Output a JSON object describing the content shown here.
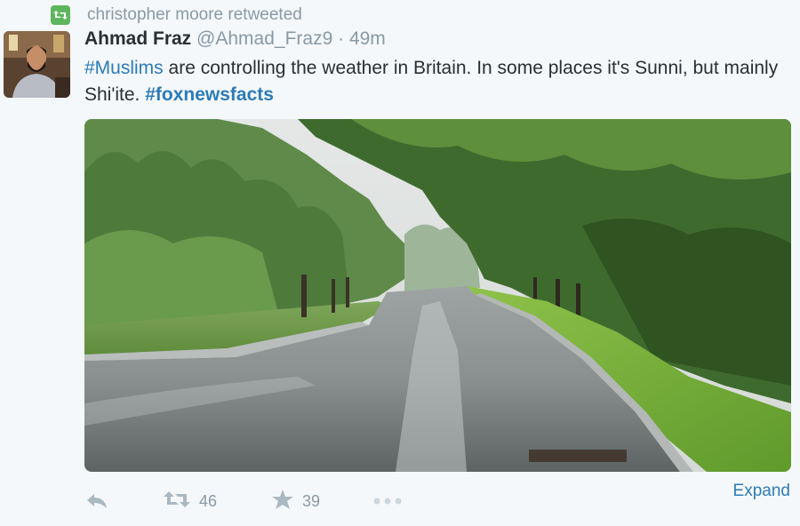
{
  "retweet": {
    "text": "christopher moore retweeted",
    "icon": "retweet-badge-icon",
    "color": "#5eb65e"
  },
  "tweet": {
    "name": "Ahmad Fraz",
    "handle": "@Ahmad_Fraz9",
    "separator": "·",
    "time": "49m",
    "text_parts": {
      "hashtag1": "#Muslims",
      "body1": " are controlling the weather in Britain. In some places it's Sunni, but mainly Shi'ite. ",
      "hashtag2": "#foxnewsfacts"
    },
    "link_color": "#2b7bb9"
  },
  "actions": {
    "reply_icon": "reply-icon",
    "retweet_icon": "retweet-icon",
    "retweet_count": "46",
    "favorite_icon": "star-icon",
    "favorite_count": "39",
    "more_icon": "more-icon",
    "expand_label": "Expand"
  }
}
